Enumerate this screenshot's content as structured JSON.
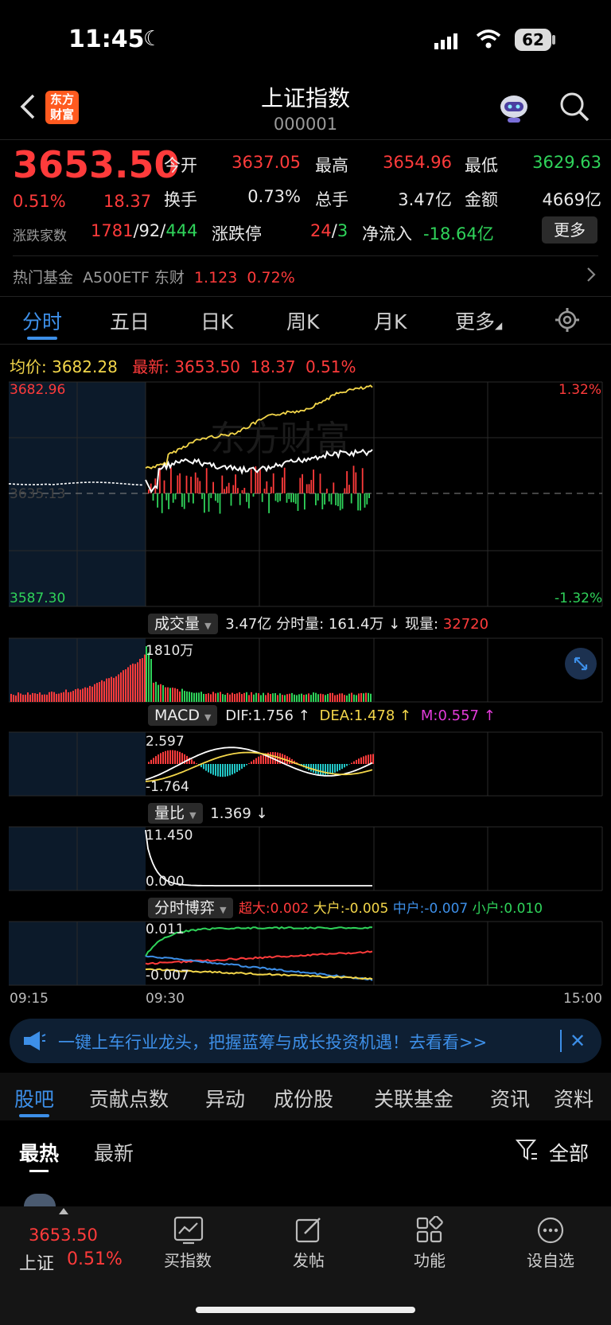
{
  "status_bar": {
    "time": "11:45",
    "battery": "62"
  },
  "header": {
    "title": "上证指数",
    "code": "000001",
    "logo_text": "东方\n财富",
    "back_icon": "chevron-left-icon",
    "assistant_icon": "robot-icon",
    "search_icon": "search-icon"
  },
  "quote": {
    "price": "3653.50",
    "change_pct": "0.51%",
    "change": "18.37",
    "open_label": "今开",
    "open": "3637.05",
    "high_label": "最高",
    "high": "3654.96",
    "low_label": "最低",
    "low": "3629.63",
    "turnover_label": "换手",
    "turnover": "0.73%",
    "volume_label": "总手",
    "volume": "3.47亿",
    "amount_label": "金额",
    "amount": "4669亿",
    "breadth_label": "涨跌家数",
    "up": "1781",
    "flat": "92",
    "down": "444",
    "limit_label": "涨跌停",
    "limit_up": "24",
    "limit_down": "3",
    "netflow_label": "净流入",
    "netflow": "-18.64亿",
    "more_button": "更多"
  },
  "fund": {
    "label": "热门基金",
    "name": "A500ETF 东财",
    "price": "1.123",
    "pct": "0.72%"
  },
  "period_tabs": [
    "分时",
    "五日",
    "日K",
    "周K",
    "月K",
    "更多"
  ],
  "main_chart": {
    "avg_label": "均价:",
    "avg": "3682.28",
    "latest_label": "最新:",
    "latest": "3653.50",
    "latest_change": "18.37",
    "latest_pct": "0.51%",
    "y_top": "3682.96",
    "y_bottom": "3587.30",
    "pct_top": "1.32%",
    "pct_bottom": "-1.32%",
    "prev_close_label": "3635.13",
    "watermark": "东方财富"
  },
  "volume_panel": {
    "chip": "成交量",
    "total": "3.47亿",
    "min_label": "分时量:",
    "min_vol": "161.4万",
    "now_label": "现量:",
    "now": "32720",
    "axis_top": "1810万"
  },
  "macd_panel": {
    "chip": "MACD",
    "dif": "DIF:1.756 ↑",
    "dea": "DEA:1.478 ↑",
    "m": "M:0.557 ↑",
    "top": "2.597",
    "bottom": "-1.764"
  },
  "ratio_panel": {
    "chip": "量比",
    "value": "1.369 ↓",
    "top": "11.450",
    "bottom": "0.000"
  },
  "game_panel": {
    "chip": "分时博弈",
    "super": "超大:0.002",
    "large": "大户:-0.005",
    "mid": "中户:-0.007",
    "small": "小户:0.010",
    "top": "0.011",
    "bottom": "-0.007"
  },
  "time_axis": {
    "t1": "09:15",
    "t2": "09:30",
    "t3": "15:00"
  },
  "banner": {
    "text": "一键上车行业龙头，把握蓝筹与成长投资机遇！去看看>>"
  },
  "content_tabs": [
    "股吧",
    "贡献点数",
    "异动",
    "成份股",
    "关联基金",
    "资讯",
    "资料"
  ],
  "sub_tabs": {
    "hot": "最热",
    "new": "最新",
    "filter": "全部"
  },
  "bottom_bar": {
    "price": "3653.50",
    "name": "上证",
    "pct": "0.51%",
    "items": [
      "买指数",
      "发帖",
      "功能",
      "设自选"
    ]
  },
  "colors": {
    "up": "#ff3b3b",
    "down": "#2fd35a",
    "accent": "#3d8fe8",
    "avg_line": "#f3d64a"
  }
}
